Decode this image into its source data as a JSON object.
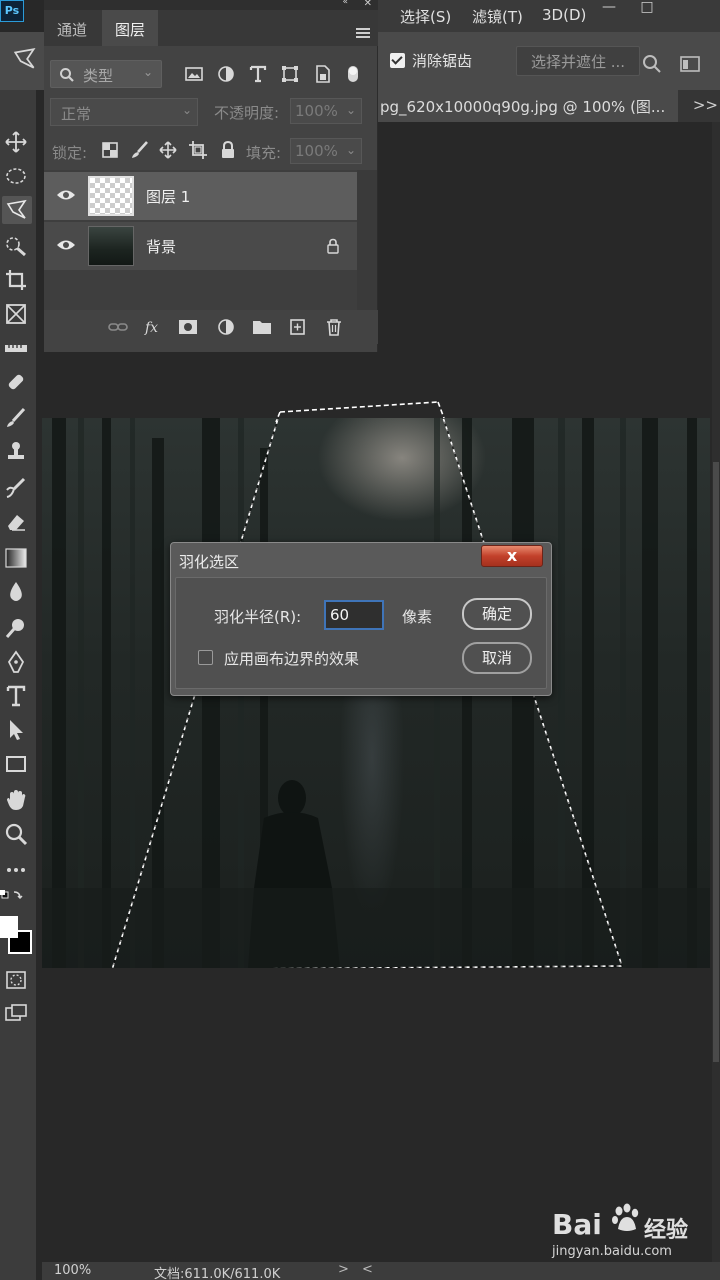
{
  "menubar": {
    "items": [
      "选择(S)",
      "滤镜(T)",
      "3D(D)"
    ],
    "window_controls": [
      "—",
      "□"
    ]
  },
  "options_bar": {
    "anti_alias_label": "消除锯齿",
    "anti_alias_checked": true,
    "select_mask_label": "选择并遮住 ..."
  },
  "document_tab": {
    "label": "pg_620x10000q90g.jpg @ 100% (图...",
    "more": ">>"
  },
  "toolbar": {
    "app_logo": "Ps"
  },
  "layers_panel": {
    "tabs": [
      "通道",
      "图层"
    ],
    "active_tab": "图层",
    "filter_label": "类型",
    "blend_mode": "正常",
    "opacity_label": "不透明度:",
    "opacity_value": "100%",
    "lock_label": "锁定:",
    "fill_label": "填充:",
    "fill_value": "100%",
    "layers": [
      {
        "name": "图层 1",
        "selected": true,
        "visible": true
      },
      {
        "name": "背景",
        "selected": false,
        "visible": true,
        "locked": true
      }
    ]
  },
  "dialog": {
    "title": "羽化选区",
    "close_label": "x",
    "radius_label": "羽化半径(R):",
    "radius_value": "60",
    "unit": "像素",
    "canvas_bounds_label": "应用画布边界的效果",
    "canvas_bounds_checked": false,
    "ok_label": "确定",
    "cancel_label": "取消"
  },
  "statusbar": {
    "zoom": "100%",
    "doc_info": "文档:611.0K/611.0K",
    "arrow_right": ">",
    "arrow_left": "<"
  },
  "watermark": {
    "brand": "Bai",
    "jingyan": "经验",
    "url": "jingyan.baidu.com"
  }
}
